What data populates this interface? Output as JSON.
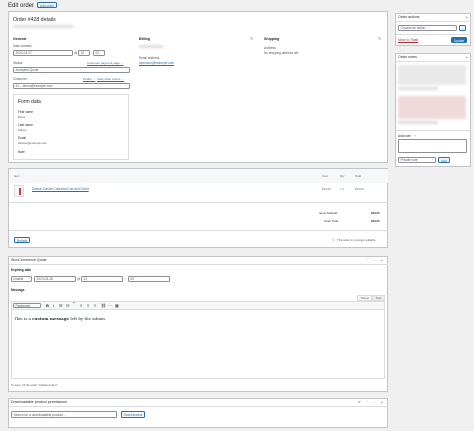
{
  "header": {
    "title": "Edit order",
    "add_order_button": "Add order"
  },
  "order": {
    "title": "Order #428 details",
    "general_heading": "General",
    "date_created_label": "Date created:",
    "date_value": "2023-03-27",
    "hour_value": "10",
    "minute_value": "02",
    "at_label": "@",
    "colon": ":",
    "status_label": "Status:",
    "status_value": "Accepted Quote",
    "customer_label": "Customer:",
    "customer_payment_link": "Customer payment page →",
    "profile_link": "Profile →",
    "view_other_orders_link": "View other orders →",
    "customer_value": "#1 – demo@example.com",
    "billing_heading": "Billing",
    "billing_email_label": "Email address:",
    "billing_email_value": "bjohnson@example.com",
    "shipping_heading": "Shipping",
    "shipping_address_label": "Address:",
    "shipping_address_value": "No shipping address set.",
    "form_data": {
      "title": "Form data",
      "first_name_label": "First name",
      "first_name_value": "Bruce",
      "last_name_label": "Last name",
      "last_name_value": "Wayne",
      "email_label": "Email",
      "email_value": "batman@example.com",
      "note_label": "Note"
    }
  },
  "items": {
    "col_item": "Item",
    "col_cost": "Cost",
    "col_qty": "Qty",
    "col_total": "Total",
    "rows": [
      {
        "name": "Dismal Sunset Collection List and Chest",
        "cost": "$16.00",
        "qty": "× 1",
        "total": "$16.00"
      }
    ],
    "subtotal_label": "Items Subtotal:",
    "subtotal_value": "$16.00",
    "order_total_label": "Order Total:",
    "order_total_value": "$16.00",
    "not_editable_note": "This order is no longer editable.",
    "refund_button": "Refund"
  },
  "quote": {
    "title": "WooCommerce Quote",
    "expiring_label": "Expiring date",
    "enable_value": "Enable",
    "expire_date": "2023-03-28",
    "expire_hour": "22",
    "expire_minute": "00",
    "message_label": "Message",
    "tab_visual": "Visual",
    "tab_text": "Text",
    "paragraph_select": "Paragraph",
    "message_before": "This is a ",
    "message_bold": "custom message",
    "message_after": " left by the admin.",
    "hint": "To save, hit the order \"Update button\"."
  },
  "downloads": {
    "title": "Downloadable product permissions",
    "search_placeholder": "Search for a downloadable product...",
    "grant_button": "Grant access"
  },
  "sidebar": {
    "actions_title": "Order actions",
    "action_select": "Choose an action...",
    "go_button": "›",
    "trash_link": "Move to Trash",
    "update_button": "Update",
    "notes_title": "Order notes",
    "add_note_label": "Add note",
    "note_type": "Private note",
    "add_button": "Add"
  }
}
